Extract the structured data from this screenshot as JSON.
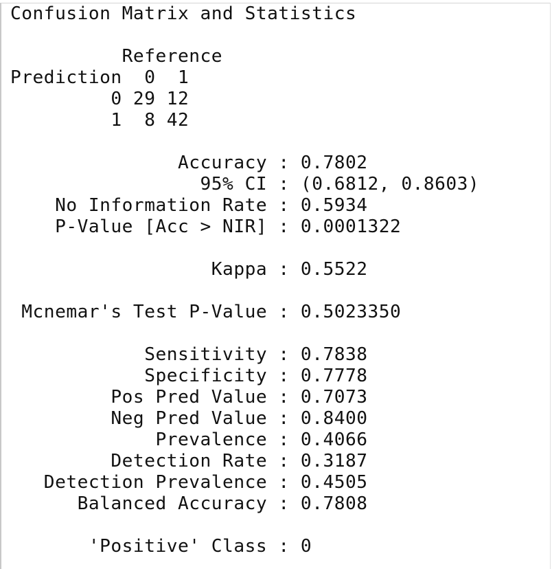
{
  "console": {
    "lines": [
      "Confusion Matrix and Statistics",
      "",
      "          Reference",
      "Prediction  0  1",
      "         0 29 12",
      "         1  8 42",
      "",
      "               Accuracy : 0.7802",
      "                 95% CI : (0.6812, 0.8603)",
      "    No Information Rate : 0.5934",
      "    P-Value [Acc > NIR] : 0.0001322",
      "",
      "                  Kappa : 0.5522",
      "",
      " Mcnemar's Test P-Value : 0.5023350",
      "",
      "            Sensitivity : 0.7838",
      "            Specificity : 0.7778",
      "         Pos Pred Value : 0.7073",
      "         Neg Pred Value : 0.8400",
      "             Prevalence : 0.4066",
      "         Detection Rate : 0.3187",
      "   Detection Prevalence : 0.4505",
      "      Balanced Accuracy : 0.7808",
      "",
      "       'Positive' Class : 0"
    ]
  }
}
